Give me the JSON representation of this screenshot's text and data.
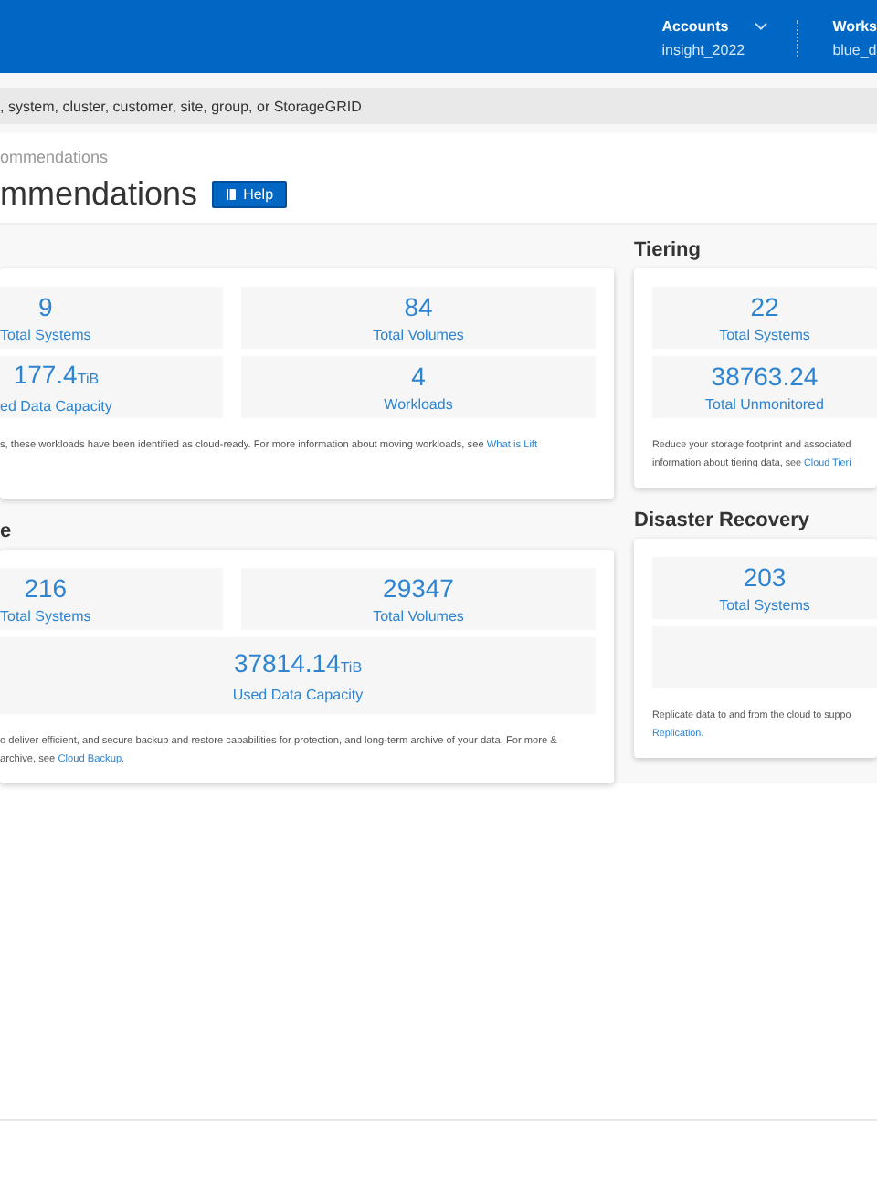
{
  "header": {
    "menus": [
      {
        "label": "Accounts",
        "value": "insight_2022",
        "dropdown": true
      },
      {
        "label": "Works",
        "value": "blue_d",
        "dropdown": false
      }
    ]
  },
  "search": {
    "placeholder": ", system, cluster, customer, site, group, or StorageGRID"
  },
  "breadcrumb": "ommendations",
  "page_title": "mmendations",
  "help_button": "Help",
  "columns": [
    {
      "sections": [
        {
          "tiles": [
            {
              "kind": "stat",
              "value": "9",
              "label": "Total Systems"
            },
            {
              "kind": "stat",
              "value": "84",
              "label": "Total Volumes"
            },
            {
              "kind": "stat",
              "value": "177.4",
              "unit": "TiB",
              "label": "ed Data Capacity"
            },
            {
              "kind": "stat",
              "value": "4",
              "label": "Workloads"
            }
          ],
          "description": {
            "text": "s, these workloads have been identified as cloud-ready. For more information about moving workloads, see",
            "link": "What is Lift"
          }
        },
        {
          "title": "e",
          "tiles": [
            {
              "kind": "stat",
              "value": "216",
              "label": "Total Systems"
            },
            {
              "kind": "stat",
              "value": "29347",
              "label": "Total Volumes"
            },
            {
              "kind": "wide",
              "value": "37814.14",
              "unit": "TiB",
              "label": "Used Data Capacity"
            }
          ],
          "description": {
            "text": "o deliver efficient, and secure backup and restore capabilities for protection, and long-term archive of your data. For more & archive, see",
            "link": "Cloud Backup."
          }
        }
      ]
    },
    {
      "sections": [
        {
          "title": "Tiering",
          "tiles": [
            {
              "kind": "stat",
              "value": "22",
              "label": "Total Systems"
            },
            {
              "kind": "stat",
              "value": "38763.24",
              "label": "Total Unmonitored"
            }
          ],
          "description": {
            "text": "Reduce your storage footprint and associated information about tiering data, see",
            "link": "Cloud Tieri"
          }
        },
        {
          "title": "Disaster Recovery",
          "tiles": [
            {
              "kind": "stat",
              "value": "203",
              "label": "Total Systems"
            },
            {
              "kind": "empty"
            }
          ],
          "description": {
            "text": "Replicate data to and from the cloud to suppo",
            "link": "Replication."
          }
        }
      ]
    }
  ]
}
